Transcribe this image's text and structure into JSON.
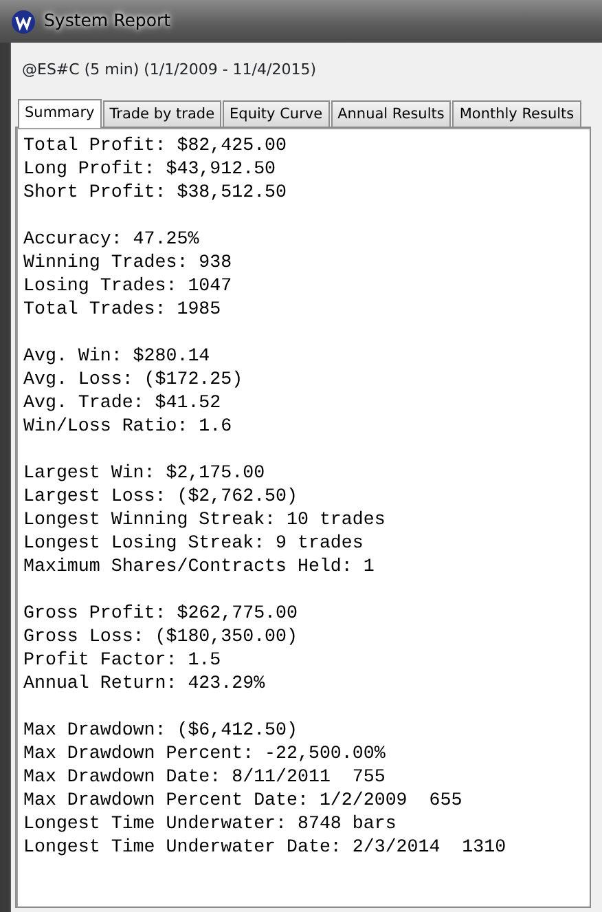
{
  "window": {
    "title": "System Report"
  },
  "subtitle": "@ES#C (5 min)  (1/1/2009 - 11/4/2015)",
  "tabs": [
    {
      "label": "Summary",
      "selected": true
    },
    {
      "label": "Trade by trade",
      "selected": false
    },
    {
      "label": "Equity Curve",
      "selected": false
    },
    {
      "label": "Annual Results",
      "selected": false
    },
    {
      "label": "Monthly Results",
      "selected": false
    }
  ],
  "report_groups": [
    [
      "Total Profit: $82,425.00",
      "Long Profit: $43,912.50",
      "Short Profit: $38,512.50"
    ],
    [
      "Accuracy: 47.25%",
      "Winning Trades: 938",
      "Losing Trades: 1047",
      "Total Trades: 1985"
    ],
    [
      "Avg. Win: $280.14",
      "Avg. Loss: ($172.25)",
      "Avg. Trade: $41.52",
      "Win/Loss Ratio: 1.6"
    ],
    [
      "Largest Win: $2,175.00",
      "Largest Loss: ($2,762.50)",
      "Longest Winning Streak: 10 trades",
      "Longest Losing Streak: 9 trades",
      "Maximum Shares/Contracts Held: 1"
    ],
    [
      "Gross Profit: $262,775.00",
      "Gross Loss: ($180,350.00)",
      "Profit Factor: 1.5",
      "Annual Return: 423.29%"
    ],
    [
      "Max Drawdown: ($6,412.50)",
      "Max Drawdown Percent: -22,500.00%",
      "Max Drawdown Date: 8/11/2011  755",
      "Max Drawdown Percent Date: 1/2/2009  655",
      "Longest Time Underwater: 8748 bars",
      "Longest Time Underwater Date: 2/3/2014  1310"
    ]
  ]
}
